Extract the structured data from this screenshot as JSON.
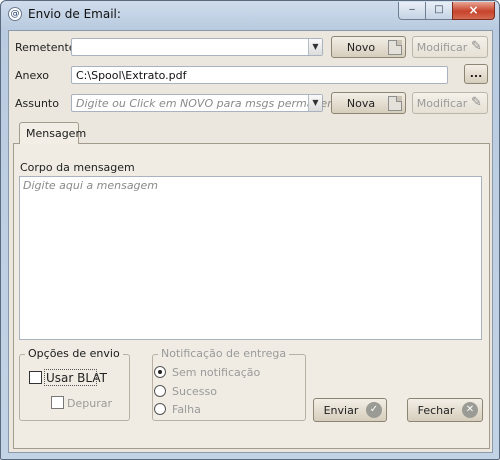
{
  "window": {
    "title": "Envio de Email:",
    "close_glyph": "×",
    "min_glyph": "‒",
    "max_glyph": "□"
  },
  "form": {
    "remetente": {
      "label": "Remetente",
      "value": "",
      "new_button": "Novo",
      "modify_button": "Modificar"
    },
    "anexo": {
      "label": "Anexo",
      "value": "C:\\Spool\\Extrato.pdf",
      "browse_button": "..."
    },
    "assunto": {
      "label": "Assunto",
      "placeholder": "Digite ou Click em NOVO para msgs permanentes",
      "new_button": "Nova",
      "modify_button": "Modificar"
    }
  },
  "tabs": [
    {
      "label": "Mensagem",
      "selected": true
    }
  ],
  "message": {
    "label": "Corpo da mensagem",
    "placeholder": "Digite aqui a mensagem"
  },
  "send_options": {
    "title": "Opções de envio",
    "usar_blat": {
      "label": "Usar BLAT",
      "checked": false
    },
    "depurar": {
      "label": "Depurar",
      "checked": false,
      "enabled": false
    }
  },
  "delivery_notification": {
    "title": "Notificação de entrega",
    "options": [
      {
        "label": "Sem notificação",
        "selected": true
      },
      {
        "label": "Sucesso",
        "selected": false
      },
      {
        "label": "Falha",
        "selected": false
      }
    ]
  },
  "actions": {
    "send": {
      "label": "Enviar",
      "icon": "check-circle-icon"
    },
    "close": {
      "label": "Fechar",
      "icon": "close-circle-icon"
    }
  },
  "icons": {
    "app": "@",
    "check": "✓",
    "x": "✕",
    "pencil": "✎",
    "combo_arrow": "▼"
  }
}
